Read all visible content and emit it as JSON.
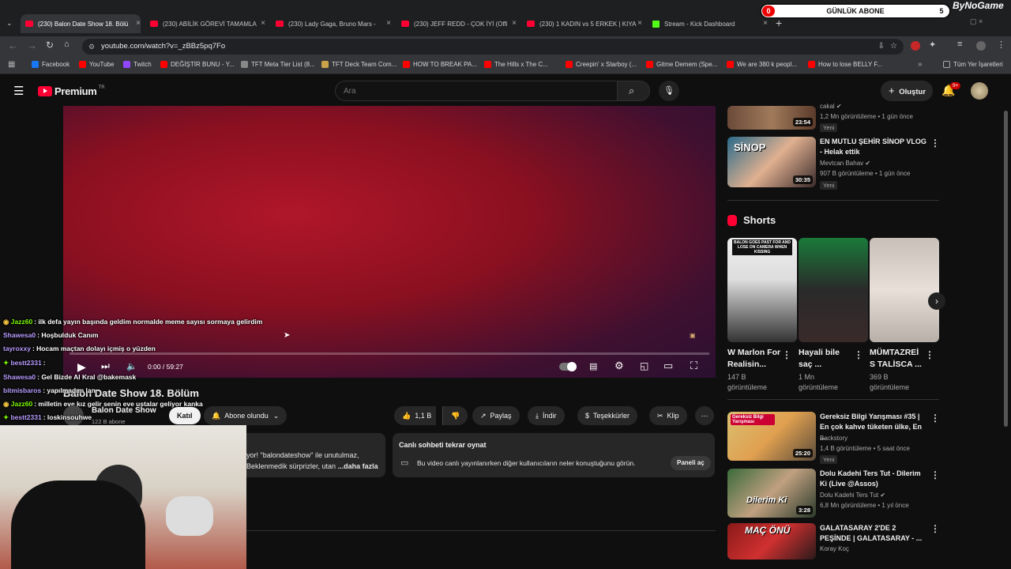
{
  "browser": {
    "tabs": [
      {
        "title": "(230) Balon Date Show 18. Bölü",
        "icon": "youtube",
        "active": true
      },
      {
        "title": "(230) ABİLİK GÖREVİ TAMAMLA",
        "icon": "youtube"
      },
      {
        "title": "(230) Lady Gaga, Bruno Mars -",
        "icon": "youtube"
      },
      {
        "title": "(230) JEFF REDD - ÇOK İYİ (Offi",
        "icon": "youtube"
      },
      {
        "title": "(230) 1 KADIN vs 5 ERKEK | KIYA",
        "icon": "youtube"
      },
      {
        "title": "Stream - Kick Dashboard",
        "icon": "kick"
      }
    ],
    "url": "youtube.com/watch?v=_zBBz5pq7Fo",
    "bookmarks": [
      {
        "label": "Facebook",
        "color": "#1877f2"
      },
      {
        "label": "YouTube",
        "color": "#ff0000"
      },
      {
        "label": "Twitch",
        "color": "#9146ff"
      },
      {
        "label": "DEĞİŞTİR BUNU - Y...",
        "color": "#ff0000"
      },
      {
        "label": "TFT Meta Tier List (8...",
        "color": "#888888"
      },
      {
        "label": "TFT Deck Team Com...",
        "color": "#c9a24a"
      },
      {
        "label": "HOW TO BREAK PA...",
        "color": "#ff0000"
      },
      {
        "label": "The Hills x The C...",
        "color": "#ff0000"
      },
      {
        "label": "Creepin' x Starboy (...",
        "color": "#ff0000"
      },
      {
        "label": "Gitme Demem (Spe...",
        "color": "#ff0000"
      },
      {
        "label": "We are 380 k peopl...",
        "color": "#ff0000"
      },
      {
        "label": "How to lose BELLY F...",
        "color": "#ff0000"
      }
    ],
    "all_bookmarks": "Tüm Yer İşaretleri"
  },
  "overlay": {
    "abone_label": "GÜNLÜK ABONE",
    "abone_left": "0",
    "abone_right": "5",
    "brand": "ByNoGame"
  },
  "youtube": {
    "logo": "Premium",
    "logo_region": "TR",
    "search_placeholder": "Ara",
    "create_label": "Oluştur",
    "notif_count": "9+"
  },
  "player": {
    "time": "0:00 / 59:27",
    "progress": 0
  },
  "chat": [
    {
      "user": "Jazz60",
      "color": "#7cfc00",
      "msg": ": ilk defa yayın başında geldim normalde meme sayısı sormaya gelirdim"
    },
    {
      "user": "Shawesa0",
      "color": "#b89cff",
      "msg": ": Hoşbulduk Canım"
    },
    {
      "user": "tayroxxy",
      "color": "#b89cff",
      "msg": ": Hocam maçtan dolayı içmiş o yüzden"
    },
    {
      "user": "bestt2331",
      "color": "#b89cff",
      "msg": ":"
    },
    {
      "user": "Shawesa0",
      "color": "#b89cff",
      "msg": ": Gel Bizde Al Kral @bakemask"
    },
    {
      "user": "bitmisbaros",
      "color": "#b89cff",
      "msg": ": yapılmadım lan"
    },
    {
      "user": "Jazz60",
      "color": "#7cfc00",
      "msg": ": milletin eve kız gelir senin eve ustalar geliyor kanka"
    },
    {
      "user": "bestt2331",
      "color": "#b89cff",
      "msg": ": loskinsouhwe"
    }
  ],
  "video": {
    "title": "Balon Date Show 18. Bölüm",
    "channel": "Balon Date Show",
    "subs": "122 B abone",
    "join_label": "Katıl",
    "subscribed_label": "Abone olundu",
    "likes": "1,1 B",
    "share_label": "Paylaş",
    "download_label": "İndir",
    "thanks_label": "Teşekkürler",
    "clip_label": "Klip",
    "desc_line1": "yor! \"balondateshow\" ile unutulmaz,",
    "desc_line2": "Beklenmedik sürprizler, utan",
    "desc_more": "...daha fazla",
    "replay_title": "Canlı sohbeti tekrar oynat",
    "replay_desc": "Bu video canlı yayınlanırken diğer kullanıcıların neler konuştuğunu görün.",
    "replay_btn": "Paneli aç"
  },
  "sidebar": {
    "top": [
      {
        "title": "",
        "channel": "cakal",
        "meta": "1,2 Mn görüntüleme • 1 gün önce",
        "badge": "Yeni",
        "duration": "23:54"
      },
      {
        "title": "EN MUTLU ŞEHİR SİNOP VLOG - Helak ettik",
        "channel": "Mevtcan Bahav",
        "meta": "907 B görüntüleme • 1 gün önce",
        "badge": "Yeni",
        "duration": "30:35",
        "thumb_text": "SİNOP"
      }
    ],
    "shorts_heading": "Shorts",
    "shorts": [
      {
        "title": "W Marlon For Realisin...",
        "views": "147 B görüntüleme",
        "caption": "BALON GOES PAST FOR AND LOSE ON CAMERA WHEN KISSING"
      },
      {
        "title": "Hayali bile saç ...",
        "views": "1 Mn görüntüleme"
      },
      {
        "title": "MÜMTAZREİ S TALİSCA ...",
        "views": "369 B görüntüleme"
      }
    ],
    "bottom": [
      {
        "title": "Gereksiz Bilgi Yarışması #35 | En çok kahve tüketen ülke, En ...",
        "channel": "Backstory",
        "meta": "1,4 B görüntüleme • 5 saat önce",
        "badge": "Yeni",
        "duration": "25:20",
        "thumb_text": "Gereksiz Bilgi Yarışması"
      },
      {
        "title": "Dolu Kadehi Ters Tut - Dilerim Ki (Live @Assos)",
        "channel": "Dolu Kadehi Ters Tut",
        "meta": "6,8 Mn görüntüleme • 1 yıl önce",
        "duration": "3:28",
        "thumb_text": "Dilerim Ki"
      },
      {
        "title": "GALATASARAY 2'DE 2 PEŞİNDE | GALATASARAY - ...",
        "channel": "Koray Koç",
        "meta": "",
        "thumb_text": "MAÇ ÖNÜ"
      }
    ]
  }
}
